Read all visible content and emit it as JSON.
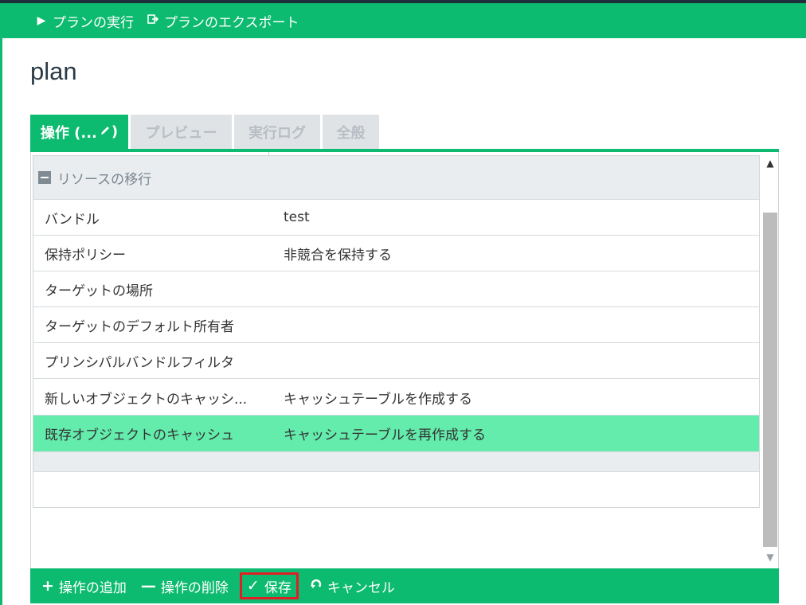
{
  "toolbar": {
    "run_label": "プランの実行",
    "export_label": "プランのエクスポート"
  },
  "page_title": "plan",
  "tabs": [
    {
      "label": "操作 (...",
      "active": true
    },
    {
      "label": "プレビュー",
      "active": false
    },
    {
      "label": "実行ログ",
      "active": false
    },
    {
      "label": "全般",
      "active": false
    }
  ],
  "section": {
    "title": "リソースの移行"
  },
  "rows": [
    {
      "label": "バンドル",
      "value": "test"
    },
    {
      "label": "保持ポリシー",
      "value": "非競合を保持する"
    },
    {
      "label": "ターゲットの場所",
      "value": ""
    },
    {
      "label": "ターゲットのデフォルト所有者",
      "value": ""
    },
    {
      "label": "プリンシパルバンドルフィルタ",
      "value": ""
    },
    {
      "label": "新しいオブジェクトのキャッシ...",
      "value": "キャッシュテーブルを作成する"
    },
    {
      "label": "既存オブジェクトのキャッシュ",
      "value": "キャッシュテーブルを再作成する"
    }
  ],
  "bottombar": {
    "add_label": "操作の追加",
    "delete_label": "操作の削除",
    "save_label": "保存",
    "cancel_label": "キャンセル"
  },
  "colors": {
    "accent": "#0cbb6f",
    "selected_row": "#63ecac",
    "highlight_border": "#e01f26"
  },
  "icons": {
    "run": "play-icon",
    "export": "export-icon",
    "edit": "pencil-icon",
    "collapse": "minus-square-icon",
    "add": "plus-icon",
    "delete": "minus-icon",
    "save": "check-icon",
    "cancel": "undo-icon"
  }
}
